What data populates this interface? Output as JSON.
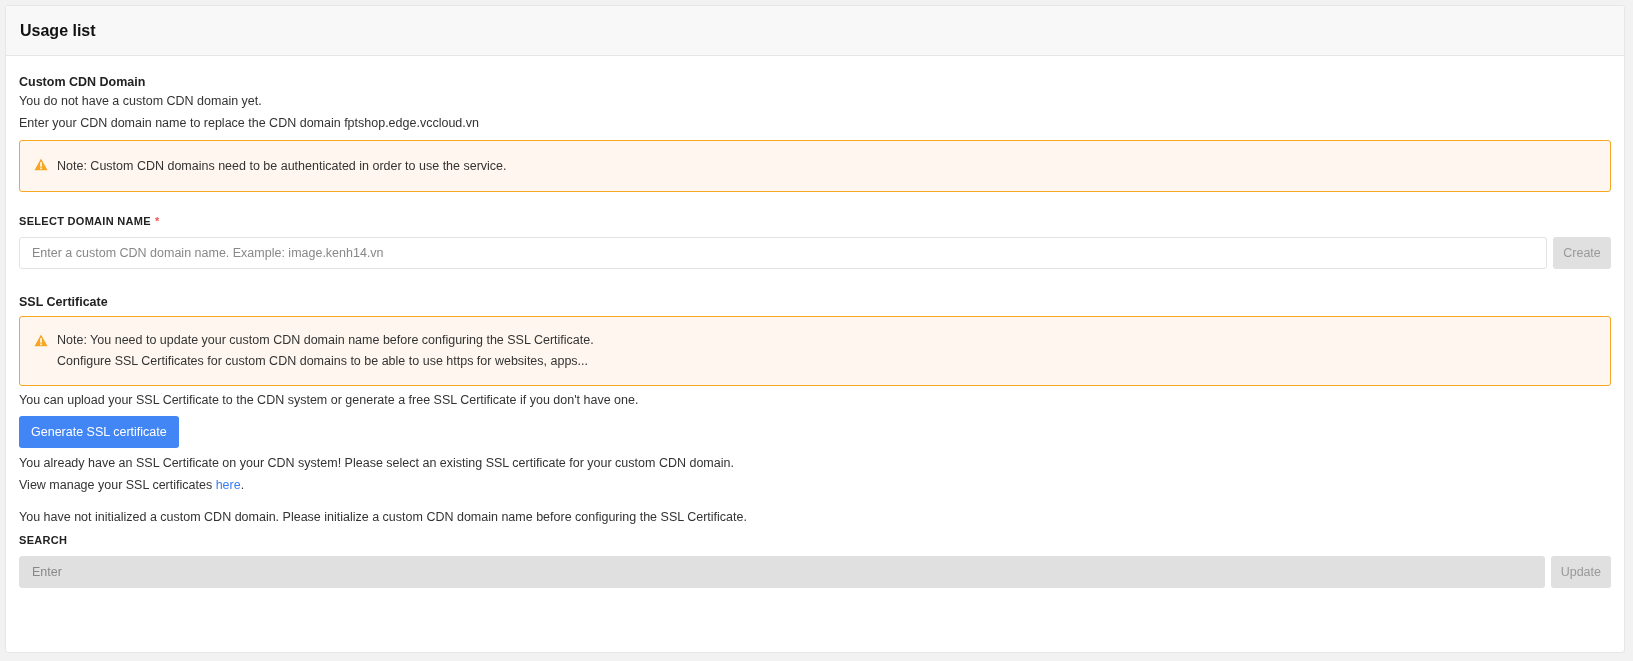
{
  "panel": {
    "title": "Usage list"
  },
  "custom_domain": {
    "heading": "Custom CDN Domain",
    "lines": [
      "You do not have a custom CDN domain yet.",
      "Enter your CDN domain name to replace the CDN domain fptshop.edge.vccloud.vn"
    ],
    "note": [
      "Note: Custom CDN domains need to be authenticated in order to use the service."
    ],
    "field_label": "SELECT DOMAIN NAME",
    "required": true,
    "required_mark": "*",
    "field": {
      "placeholder": "Enter a custom CDN domain name. Example: image.kenh14.vn",
      "disabled": false
    },
    "button": {
      "label": "Create",
      "disabled": true
    }
  },
  "ssl": {
    "heading": "SSL Certificate",
    "note": [
      "Note: You need to update your custom CDN domain name before configuring the SSL Certificate.",
      "Configure SSL Certificates for custom CDN domains to be able to use https for websites, apps..."
    ],
    "intro": "You can upload your SSL Certificate to the CDN system or generate a free SSL Certificate if you don't have one.",
    "generate_button": {
      "label": "Generate SSL certificate",
      "disabled": false
    },
    "existing": "You already have an SSL Certificate on your CDN system! Please select an existing SSL certificate for your custom CDN domain.",
    "manage_text": "View manage your SSL certificates ",
    "manage_link": "here",
    "manage_end": ".",
    "not_initialized": "You have not initialized a custom CDN domain. Please initialize a custom CDN domain name before configuring the SSL Certificate.",
    "field_label": "SEARCH",
    "field": {
      "placeholder": "Enter",
      "disabled": true
    },
    "button": {
      "label": "Update",
      "disabled": true
    }
  }
}
